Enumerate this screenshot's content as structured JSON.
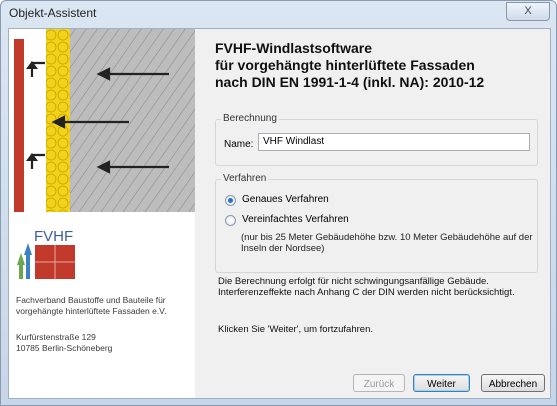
{
  "window": {
    "title": "Objekt-Assistent",
    "close_glyph": "X"
  },
  "left_panel": {
    "logo_text": "FVHF",
    "org_lines": [
      "Fachverband Baustoffe und Bauteile für",
      "vorgehängte hinterlüftete Fassaden e.V."
    ],
    "address_lines": [
      "Kurfürstenstraße 129",
      "10785 Berlin-Schöneberg"
    ]
  },
  "heading_lines": [
    "FVHF-Windlastsoftware",
    "für vorgehängte hinterlüftete Fassaden",
    "nach DIN EN 1991-1-4 (inkl. NA): 2010-12"
  ],
  "berechnung": {
    "legend": "Berechnung",
    "name_label": "Name:",
    "name_value": "VHF Windlast"
  },
  "verfahren": {
    "legend": "Verfahren",
    "option1": "Genaues Verfahren",
    "option2": "Vereinfachtes Verfahren",
    "option2_note": "(nur bis 25 Meter Gebäudehöhe bzw. 10 Meter Gebäudehöhe auf der Inseln der Nordsee)",
    "selected": "Genaues Verfahren"
  },
  "info_lines": [
    "Die Berechnung erfolgt für nicht schwingungsanfällige Gebäude.",
    "Interferenzeffekte nach Anhang C der DIN werden nicht berücksichtigt."
  ],
  "hint": "Klicken Sie 'Weiter', um fortzufahren.",
  "buttons": {
    "back": "Zurück",
    "next": "Weiter",
    "cancel": "Abbrechen"
  },
  "colors": {
    "brick": "#c0392b",
    "insulation": "#f2d21b",
    "concrete": "#b5b5b5",
    "logo_blue": "#3b82c4",
    "logo_green": "#6aa84f"
  }
}
